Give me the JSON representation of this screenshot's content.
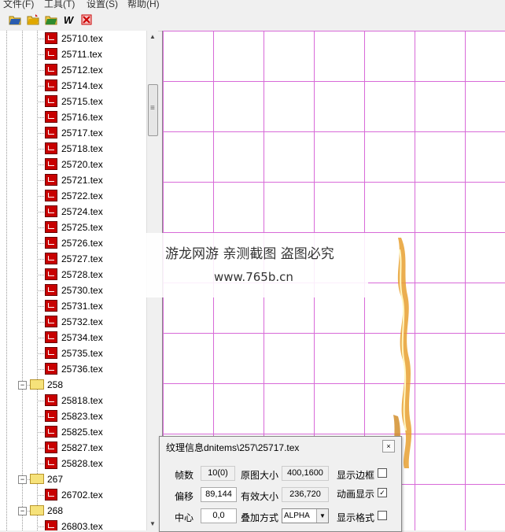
{
  "menu": [
    "文件(F)",
    "工具(T)",
    "设置(S)",
    "帮助(H)"
  ],
  "toolbar": {
    "buttons": [
      {
        "name": "open-folder-blue-icon",
        "color": "#2a5db0"
      },
      {
        "name": "open-folder-yellow-icon",
        "color": "#e0a800"
      },
      {
        "name": "open-folder-green-icon",
        "color": "#2e8b2e"
      },
      {
        "name": "w-label-button",
        "label": "W"
      },
      {
        "name": "red-cross-icon",
        "color": "#c00000"
      }
    ]
  },
  "tree": {
    "items": [
      {
        "type": "file",
        "label": "25710.tex"
      },
      {
        "type": "file",
        "label": "25711.tex"
      },
      {
        "type": "file",
        "label": "25712.tex"
      },
      {
        "type": "file",
        "label": "25714.tex"
      },
      {
        "type": "file",
        "label": "25715.tex"
      },
      {
        "type": "file",
        "label": "25716.tex"
      },
      {
        "type": "file",
        "label": "25717.tex"
      },
      {
        "type": "file",
        "label": "25718.tex"
      },
      {
        "type": "file",
        "label": "25720.tex"
      },
      {
        "type": "file",
        "label": "25721.tex"
      },
      {
        "type": "file",
        "label": "25722.tex"
      },
      {
        "type": "file",
        "label": "25724.tex"
      },
      {
        "type": "file",
        "label": "25725.tex"
      },
      {
        "type": "file",
        "label": "25726.tex"
      },
      {
        "type": "file",
        "label": "25727.tex"
      },
      {
        "type": "file",
        "label": "25728.tex"
      },
      {
        "type": "file",
        "label": "25730.tex"
      },
      {
        "type": "file",
        "label": "25731.tex"
      },
      {
        "type": "file",
        "label": "25732.tex"
      },
      {
        "type": "file",
        "label": "25734.tex"
      },
      {
        "type": "file",
        "label": "25735.tex"
      },
      {
        "type": "file",
        "label": "25736.tex"
      },
      {
        "type": "folder",
        "label": "258",
        "expander": "−"
      },
      {
        "type": "file",
        "label": "25818.tex"
      },
      {
        "type": "file",
        "label": "25823.tex"
      },
      {
        "type": "file",
        "label": "25825.tex"
      },
      {
        "type": "file",
        "label": "25827.tex"
      },
      {
        "type": "file",
        "label": "25828.tex"
      },
      {
        "type": "folder",
        "label": "267",
        "expander": "−"
      },
      {
        "type": "file",
        "label": "26702.tex"
      },
      {
        "type": "folder",
        "label": "268",
        "expander": "−"
      },
      {
        "type": "file",
        "label": "26803.tex"
      }
    ]
  },
  "watermark": {
    "line1": "游龙网游 亲测截图 盗图必究",
    "line2": "www.765b.cn"
  },
  "dialog": {
    "title": "纹理信息dnitems\\257\\25717.tex",
    "close": "×",
    "frames_label": "帧数",
    "frames_value": "10(0)",
    "orig_size_label": "原图大小",
    "orig_size_value": "400,1600",
    "show_border_label": "显示边框",
    "show_border_checked": "",
    "offset_label": "偏移",
    "offset_value": "89,144",
    "valid_size_label": "有效大小",
    "valid_size_value": "236,720",
    "anim_label": "动画显示",
    "anim_checked": "✓",
    "center_label": "中心",
    "center_value": "0,0",
    "blend_label": "叠加方式",
    "blend_value": "ALPHA",
    "show_format_label": "显示格式",
    "show_format_checked": ""
  },
  "colors": {
    "grid": "#d86ad8",
    "flame": "#e8a030",
    "file_icon": "#c80000"
  }
}
